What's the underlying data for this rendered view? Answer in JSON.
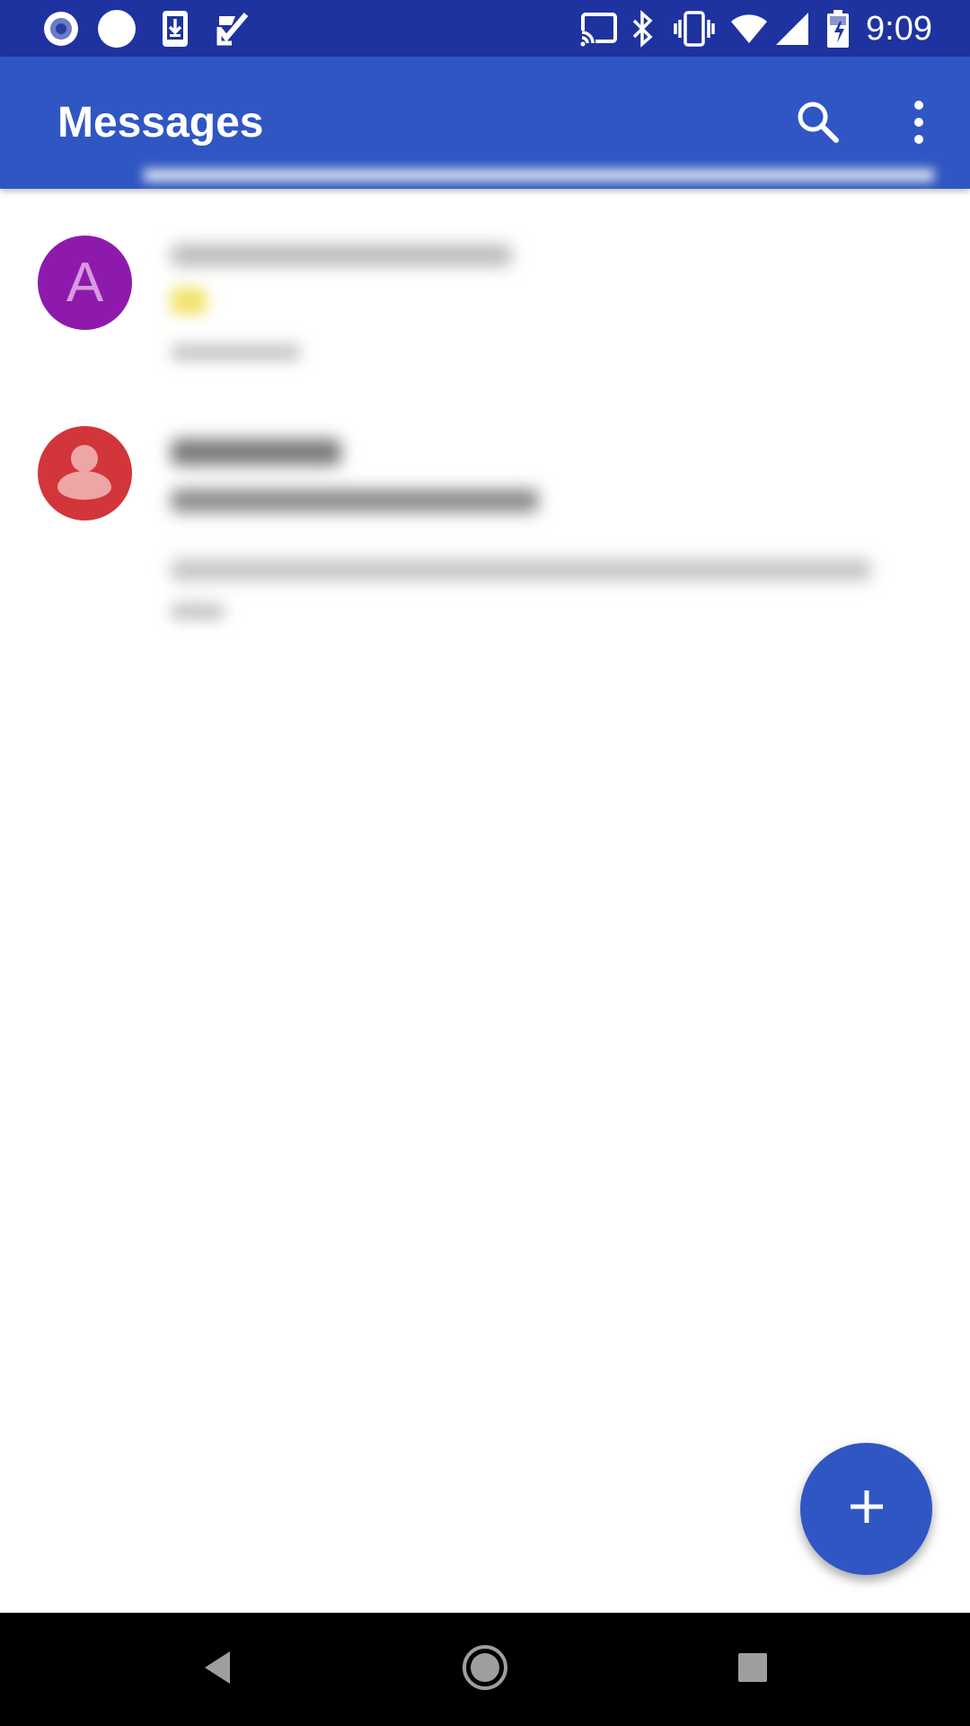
{
  "status_bar": {
    "time": "9:09",
    "icons_left": [
      "record-icon",
      "circle-icon",
      "download-icon",
      "task-check-icon"
    ],
    "icons_right": [
      "cast-icon",
      "bluetooth-icon",
      "vibrate-icon",
      "wifi-icon",
      "signal-icon",
      "battery-charging-icon"
    ],
    "background": "#1e33a0"
  },
  "app_bar": {
    "title": "Messages",
    "background": "#2f56c2",
    "actions": [
      "search-icon",
      "more-vert-icon"
    ]
  },
  "conversations": [
    {
      "avatar_letter": "A",
      "avatar_color": "#8e1aad",
      "name": "",
      "snippet": "",
      "time": "",
      "unread": false
    },
    {
      "avatar_letter": "",
      "avatar_icon": "person-icon",
      "avatar_color": "#d2353a",
      "name": "",
      "snippet": "",
      "time": "",
      "unread": true
    }
  ],
  "fab": {
    "icon": "plus-icon",
    "color": "#2f56c2"
  },
  "nav_bar": {
    "buttons": [
      "back-icon",
      "home-icon",
      "recents-icon"
    ]
  }
}
